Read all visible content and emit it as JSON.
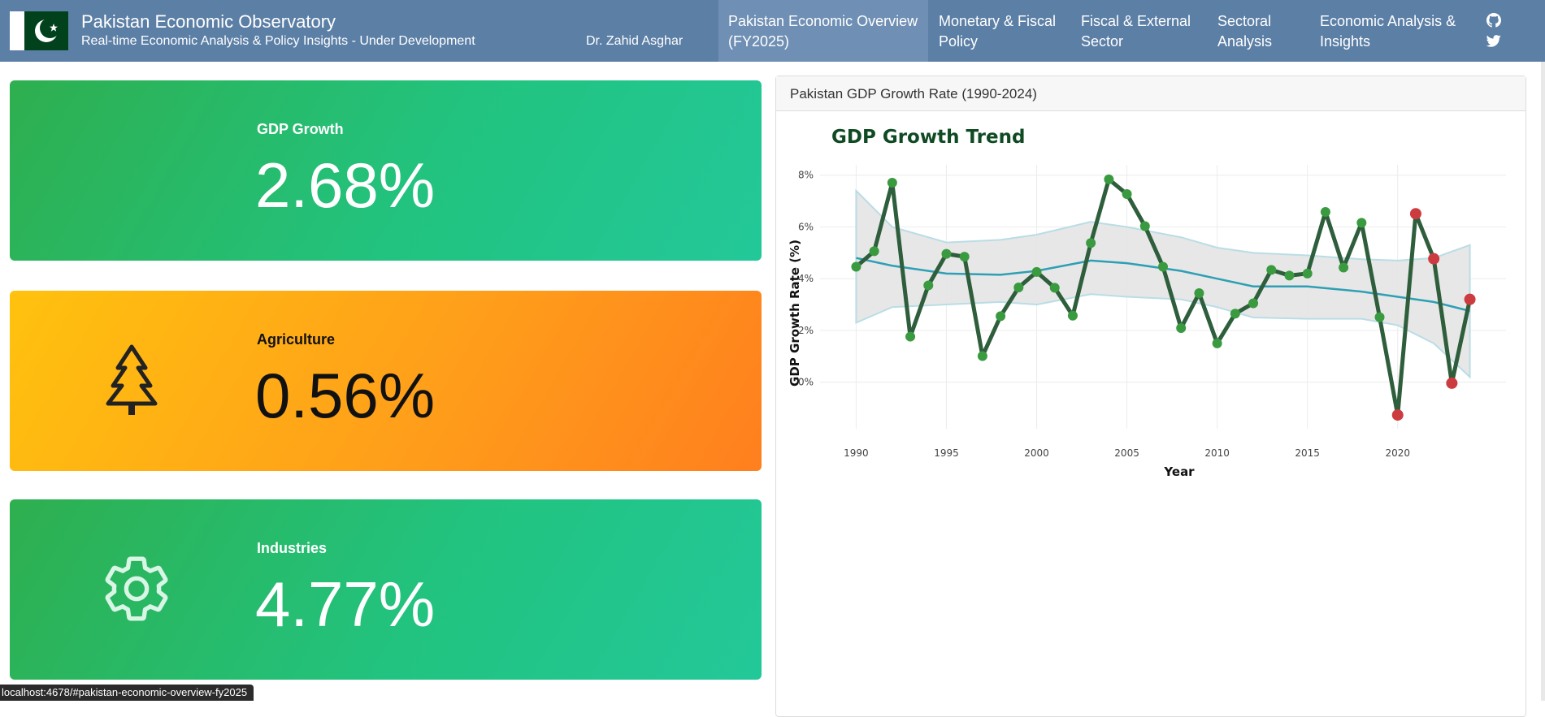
{
  "header": {
    "title": "Pakistan Economic Observatory",
    "subtitle": "Real-time Economic Analysis & Policy Insights - Under Development",
    "author": "Dr. Zahid Asghar"
  },
  "nav": {
    "items": [
      {
        "line1": "Pakistan Economic Overview",
        "line2": "(FY2025)",
        "active": true
      },
      {
        "line1": "Monetary & Fiscal",
        "line2": "Policy"
      },
      {
        "line1": "Fiscal & External",
        "line2": "Sector"
      },
      {
        "line1": "Sectoral",
        "line2": "Analysis"
      },
      {
        "line1": "Economic Analysis &",
        "line2": "Insights"
      }
    ],
    "icons": [
      "github-icon",
      "twitter-icon"
    ]
  },
  "kpis": [
    {
      "label": "GDP Growth",
      "value": "2.68%",
      "color": "green",
      "icon": "none"
    },
    {
      "label": "Agriculture",
      "value": "0.56%",
      "color": "orange",
      "icon": "tree-icon"
    },
    {
      "label": "Industries",
      "value": "4.77%",
      "color": "green",
      "icon": "gear-icon"
    }
  ],
  "colors": {
    "navbar": "#5c7fa6",
    "nav_active": "#6f8fb4",
    "line": "#2e5e3c",
    "point_normal": "#3a9a3f",
    "point_low": "#cc3b3f",
    "trend": "#2e9fb4",
    "band": "#e6e6e6",
    "title": "#0f4a23"
  },
  "panel": {
    "header": "Pakistan GDP Growth Rate (1990-2024)"
  },
  "chart_data": {
    "type": "line",
    "title": "GDP Growth Trend",
    "xlabel": "Year",
    "ylabel": "GDP Growth Rate (%)",
    "x_ticks": [
      "1990",
      "1995",
      "2000",
      "2005",
      "2010",
      "2015",
      "2020"
    ],
    "y_ticks": [
      "0%",
      "2%",
      "4%",
      "6%",
      "8%"
    ],
    "xlim": [
      1988,
      2026
    ],
    "ylim": [
      -1.8,
      8.4
    ],
    "grid": true,
    "legend": "none",
    "series": [
      {
        "x": [
          1990,
          1991,
          1992,
          1993,
          1994,
          1995,
          1996,
          1997,
          1998,
          1999,
          2000,
          2001,
          2002,
          2003,
          2004,
          2005,
          2006,
          2007,
          2008,
          2009,
          2010,
          2011,
          2012,
          2013,
          2014,
          2015,
          2016,
          2017,
          2018,
          2019,
          2020,
          2021,
          2022,
          2023,
          2024
        ],
        "values": [
          4.46,
          5.06,
          7.71,
          1.76,
          3.74,
          4.96,
          4.85,
          1.01,
          2.55,
          3.66,
          4.26,
          3.65,
          2.57,
          5.38,
          7.84,
          7.27,
          6.03,
          4.46,
          2.09,
          3.44,
          1.5,
          2.65,
          3.05,
          4.34,
          4.12,
          4.2,
          6.58,
          4.43,
          6.16,
          2.51,
          -1.27,
          6.51,
          4.77,
          -0.04,
          3.2
        ],
        "highlight_years": [
          2020,
          2021,
          2022,
          2023,
          2024
        ]
      }
    ],
    "trend": {
      "x": [
        1990,
        1992,
        1995,
        1998,
        2000,
        2003,
        2005,
        2008,
        2010,
        2012,
        2015,
        2018,
        2020,
        2022,
        2024
      ],
      "values": [
        4.8,
        4.5,
        4.2,
        4.15,
        4.3,
        4.7,
        4.6,
        4.3,
        4.0,
        3.7,
        3.7,
        3.5,
        3.3,
        3.1,
        2.75
      ],
      "band_upper": [
        7.4,
        6.0,
        5.4,
        5.5,
        5.7,
        6.2,
        6.0,
        5.6,
        5.2,
        5.0,
        4.9,
        4.75,
        4.7,
        4.8,
        5.3
      ],
      "band_lower": [
        2.3,
        2.9,
        3.0,
        3.1,
        3.0,
        3.4,
        3.3,
        3.2,
        2.9,
        2.5,
        2.45,
        2.45,
        2.2,
        1.5,
        0.2
      ]
    }
  },
  "status_url": "localhost:4678/#pakistan-economic-overview-fy2025"
}
